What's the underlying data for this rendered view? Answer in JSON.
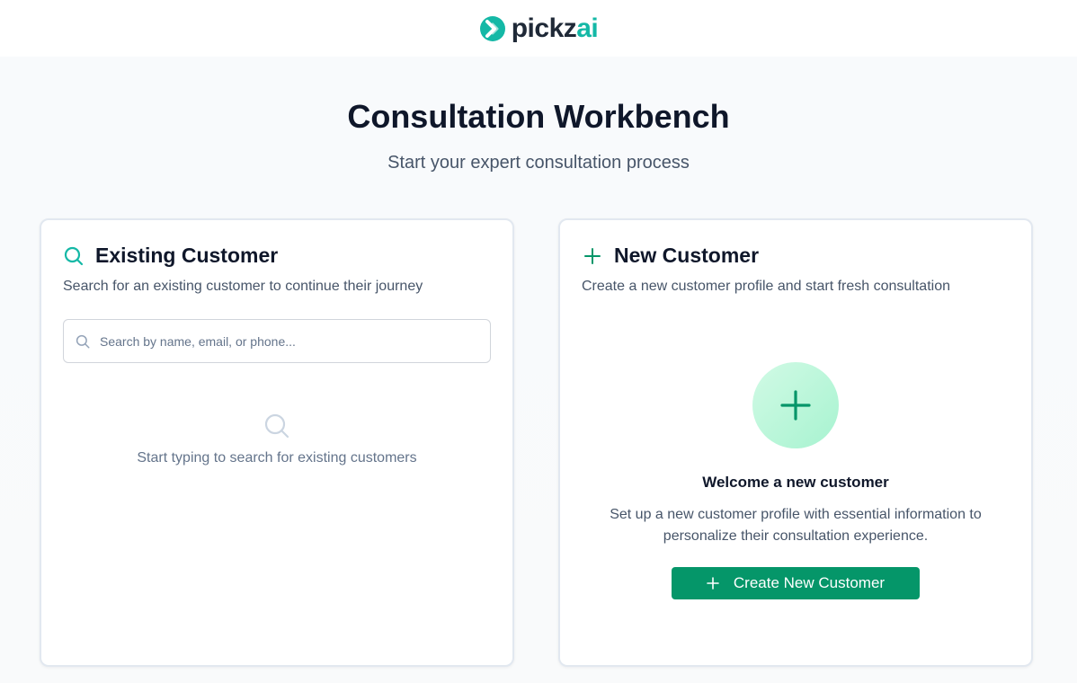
{
  "brand": {
    "name_part1": "pickz",
    "name_part2": "ai",
    "accent_color": "#14b8a6"
  },
  "page": {
    "title": "Consultation Workbench",
    "subtitle": "Start your expert consultation process"
  },
  "existing_customer": {
    "icon": "search-icon",
    "title": "Existing Customer",
    "description": "Search for an existing customer to continue their journey",
    "search": {
      "placeholder": "Search by name, email, or phone...",
      "value": ""
    },
    "empty_state": {
      "icon": "search-icon",
      "text": "Start typing to search for existing customers"
    }
  },
  "new_customer": {
    "icon": "plus-icon",
    "title": "New Customer",
    "description": "Create a new customer profile and start fresh consultation",
    "welcome_title": "Welcome a new customer",
    "welcome_desc": "Set up a new customer profile with essential information to personalize their consultation experience.",
    "button_label": "Create New Customer",
    "button_color": "#059669"
  }
}
